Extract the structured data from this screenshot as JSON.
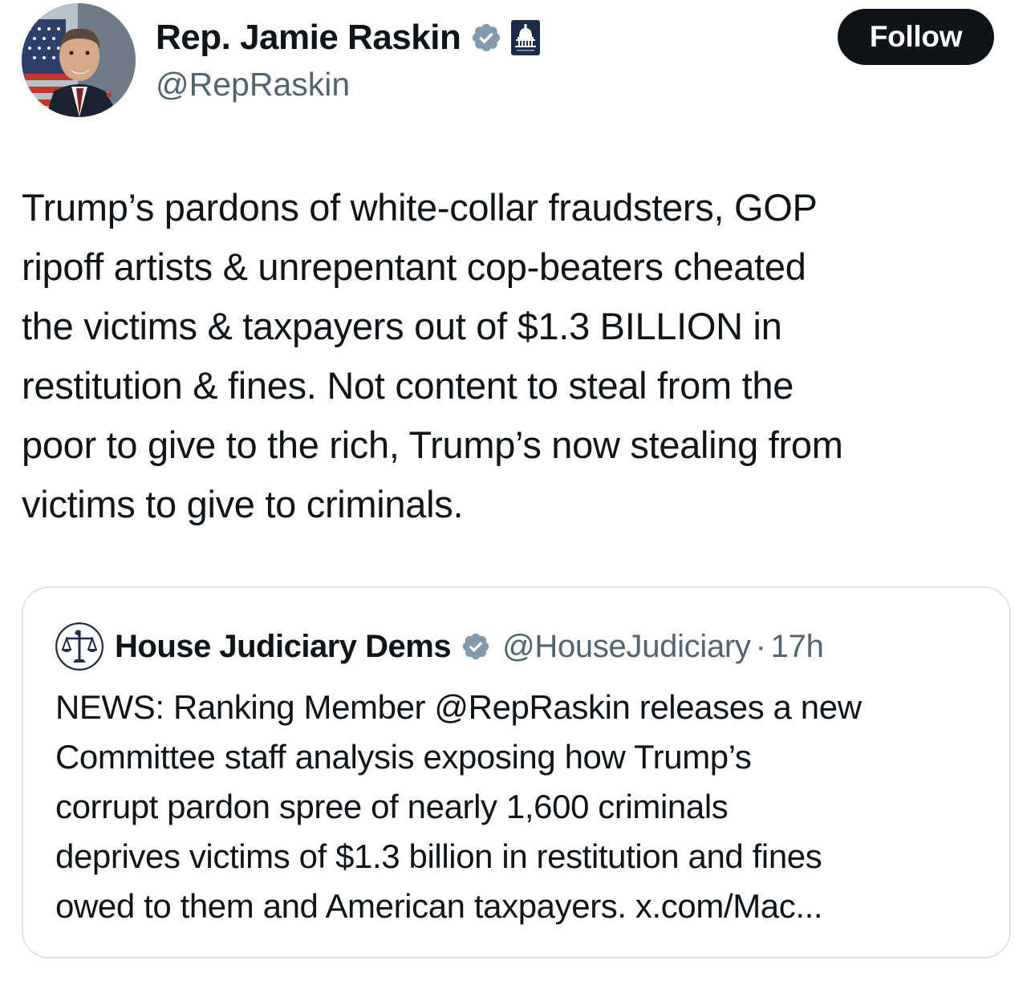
{
  "author": {
    "display_name": "Rep. Jamie Raskin",
    "handle": "@RepRaskin",
    "avatar_icon": "profile-photo",
    "verified_icon": "verified-badge-icon",
    "affiliation_icon": "house-democrats-capitol-icon"
  },
  "follow_button": {
    "label": "Follow"
  },
  "tweet": {
    "lines": [
      "Trump’s pardons of white-collar fraudsters, GOP",
      "ripoff artists & unrepentant cop-beaters cheated",
      "the victims & taxpayers out of $1.3 BILLION in",
      "restitution & fines. Not content to steal from the",
      "poor to give to the rich, Trump’s now stealing from",
      "victims to give to criminals."
    ]
  },
  "quoted_tweet": {
    "display_name": "House Judiciary Dems",
    "handle": "@HouseJudiciary",
    "separator": "·",
    "time": "17h",
    "avatar_icon": "scales-of-justice-icon",
    "lines": [
      "NEWS: Ranking Member @RepRaskin releases a new",
      "Committee staff analysis exposing how Trump’s",
      "corrupt pardon spree of nearly 1,600 criminals",
      "deprives victims of $1.3 billion in restitution and fines",
      "owed to them and American taxpayers. x.com/Mac..."
    ]
  },
  "colors": {
    "text_primary": "#0f1419",
    "text_secondary": "#536471",
    "verified_gray": "#829aab",
    "follow_bg": "#0f1419",
    "border": "#dfe4e8",
    "affiliation_bg": "#1d2a4a"
  }
}
